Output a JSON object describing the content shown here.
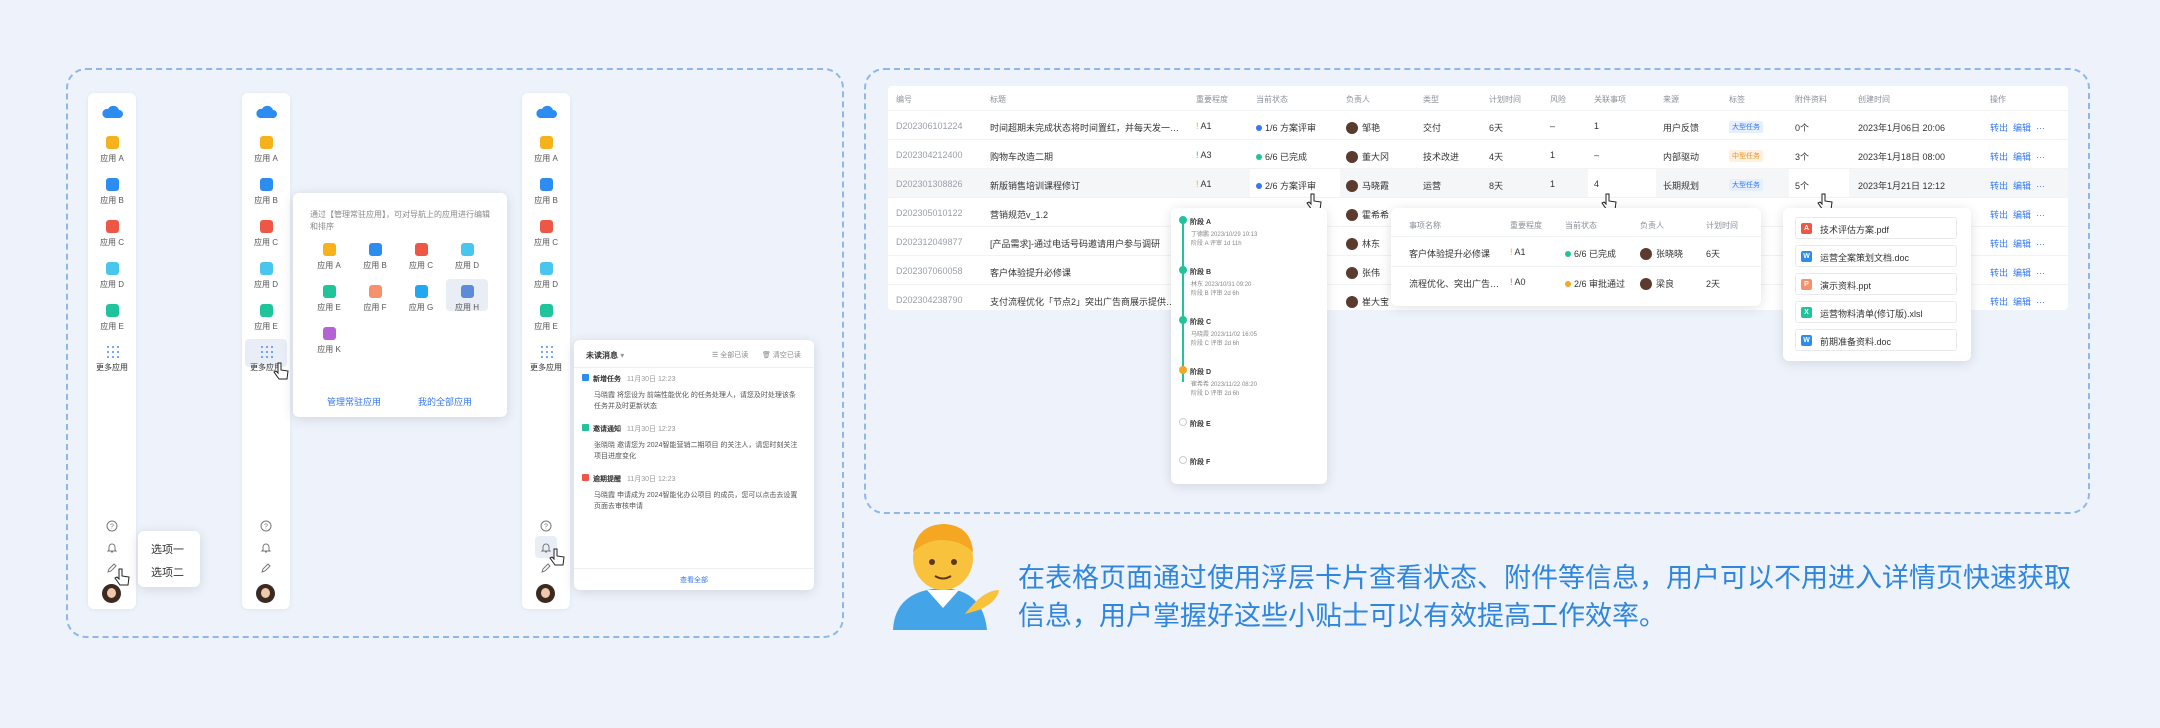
{
  "sidebar": {
    "apps": [
      {
        "label": "应用 A",
        "color": "#f5b21c"
      },
      {
        "label": "应用 B",
        "color": "#2c8cf0"
      },
      {
        "label": "应用 C",
        "color": "#ee5746"
      },
      {
        "label": "应用 D",
        "color": "#49c6ee"
      },
      {
        "label": "应用 E",
        "color": "#20c49a"
      }
    ],
    "more_label": "更多应用"
  },
  "options_menu": {
    "items": [
      "选项一",
      "选项二"
    ]
  },
  "app_panel": {
    "hint": "通过【管理常驻应用】，可对导航上的应用进行编辑和排序",
    "apps": [
      {
        "label": "应用 A",
        "color": "#f5b21c"
      },
      {
        "label": "应用 B",
        "color": "#2c8cf0"
      },
      {
        "label": "应用 C",
        "color": "#ee5746"
      },
      {
        "label": "应用 D",
        "color": "#49c6ee"
      },
      {
        "label": "应用 E",
        "color": "#20c49a"
      },
      {
        "label": "应用 F",
        "color": "#f7916c"
      },
      {
        "label": "应用 G",
        "color": "#22a8f2"
      },
      {
        "label": "应用 H",
        "color": "#5b8bd9"
      },
      {
        "label": "应用 K",
        "color": "#b463d4"
      }
    ],
    "manage_link": "管理常驻应用",
    "all_link": "我的全部应用"
  },
  "messages": {
    "header": "未读消息",
    "mark_all": "全部已读",
    "clear": "清空已读",
    "items": [
      {
        "title": "新增任务",
        "time": "11月30日 12:23",
        "body": "马晓霞 将您设为 前端性能优化 的任务处理人，请您及时处理该条任务并及时更新状态",
        "color": "#2c8cf0"
      },
      {
        "title": "邀请通知",
        "time": "11月30日 12:23",
        "body": "张晓晓 邀请您为 2024智能营销二期项目 的关注人，请您时刻关注项目进度变化",
        "color": "#20c49a"
      },
      {
        "title": "逾期提醒",
        "time": "11月30日 12:23",
        "body": "马晓霞 申请成为 2024智能化办公项目 的成员，您可以点击去设置页面去审核申请",
        "color": "#ee5746"
      }
    ],
    "view_all": "查看全部"
  },
  "table": {
    "headers": [
      "编号",
      "标题",
      "重要程度",
      "当前状态",
      "负责人",
      "类型",
      "计划时间",
      "风险",
      "关联事项",
      "来源",
      "标签",
      "附件资料",
      "创建时间",
      "操作"
    ],
    "rows": [
      {
        "id": "D202306101224",
        "title": "时间超期未完成状态将时间置红，并每天发一…",
        "pri": "A1",
        "pri_color": "#f5a623",
        "status": "1/6 方案评审",
        "status_color": "#3478f6",
        "owner": "邹艳",
        "type": "交付",
        "plan": "6天",
        "risk": "–",
        "rel": "1",
        "source": "用户反馈",
        "tag": "大型任务",
        "tag_kind": "b",
        "att": "0个",
        "created": "2023年1月06日 20:06"
      },
      {
        "id": "D202304212400",
        "title": "购物车改造二期",
        "pri": "A3",
        "pri_color": "#20c49a",
        "status": "6/6 已完成",
        "status_color": "#20c49a",
        "owner": "董大冈",
        "type": "技术改进",
        "plan": "4天",
        "risk": "1",
        "rel": "–",
        "source": "内部驱动",
        "tag": "中型任务",
        "tag_kind": "o",
        "att": "3个",
        "created": "2023年1月18日 08:00"
      },
      {
        "id": "D202301308826",
        "title": "新版销售培训课程修订",
        "pri": "A1",
        "pri_color": "#f5a623",
        "status": "2/6 方案评审",
        "status_color": "#3478f6",
        "owner": "马晓霞",
        "type": "运营",
        "plan": "8天",
        "risk": "1",
        "rel": "4",
        "source": "长期规划",
        "tag": "大型任务",
        "tag_kind": "b",
        "att": "5个",
        "created": "2023年1月21日 12:12"
      },
      {
        "id": "D202305010122",
        "title": "营销规范v_1.2",
        "owner": "霍希希"
      },
      {
        "id": "D202312049877",
        "title": "[产品需求]-通过电话号码邀请用户参与调研",
        "owner": "林东"
      },
      {
        "id": "D202307060058",
        "title": "客户体验提升必修课",
        "owner": "张伟"
      },
      {
        "id": "D202304238790",
        "title": "支付流程优化「节点2」突出广告商展示提供…",
        "owner": "崔大宝"
      }
    ],
    "ops": [
      "转出",
      "编辑",
      "…"
    ]
  },
  "stage_card": {
    "stages": [
      {
        "name": "阶段 A",
        "who": "丁德鹏",
        "date": "2023/10/29 10:13",
        "note": "阶段 A 评审 1d 11h",
        "color": "#20c49a",
        "done": true
      },
      {
        "name": "阶段 B",
        "who": "林东",
        "date": "2023/10/31 09:20",
        "note": "阶段 B 评审 2d 6h",
        "color": "#20c49a",
        "done": true
      },
      {
        "name": "阶段 C",
        "who": "马晓霞",
        "date": "2023/11/02 16:05",
        "note": "阶段 C 评审 2d 6h",
        "color": "#20c49a",
        "done": true
      },
      {
        "name": "阶段 D",
        "who": "崔希希",
        "date": "2023/11/22 08:20",
        "note": "阶段 D 评审 2d 6h",
        "color": "#f5a623",
        "done": false
      },
      {
        "name": "阶段 E",
        "color": "#c9cdd4",
        "done": false
      },
      {
        "name": "阶段 F",
        "color": "#c9cdd4",
        "done": false
      }
    ]
  },
  "related_card": {
    "headers": [
      "事项名称",
      "重要程度",
      "当前状态",
      "负责人",
      "计划时间"
    ],
    "rows": [
      {
        "name": "客户体验提升必修课",
        "pri": "A1",
        "pri_color": "#f5a623",
        "status": "6/6 已完成",
        "status_color": "#20c49a",
        "owner": "张晓晓",
        "plan": "6天"
      },
      {
        "name": "流程优化、突出广告…",
        "pri": "A0",
        "pri_color": "#ee5746",
        "status": "2/6 审批通过",
        "status_color": "#f5a623",
        "owner": "梁良",
        "plan": "2天"
      }
    ]
  },
  "files_card": {
    "files": [
      {
        "name": "技术评估方案.pdf",
        "badge": "A",
        "color": "#ee5746"
      },
      {
        "name": "运营全案策划文档.doc",
        "badge": "W",
        "color": "#2c8cf0"
      },
      {
        "name": "演示资料.ppt",
        "badge": "P",
        "color": "#f7916c"
      },
      {
        "name": "运营物料清单(修订版).xlsl",
        "badge": "X",
        "color": "#20c49a"
      },
      {
        "name": "前期准备资料.doc",
        "badge": "W",
        "color": "#2c8cf0"
      }
    ]
  },
  "caption": "在表格页面通过使用浮层卡片查看状态、附件等信息，用户可以不用进入详情页快速获取信息，用户掌握好这些小贴士可以有效提高工作效率。"
}
